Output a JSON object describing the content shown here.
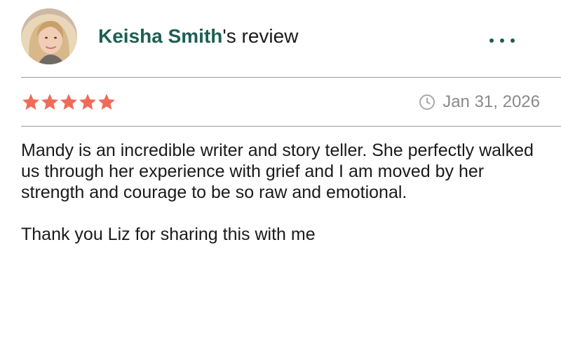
{
  "reviewer": {
    "name": "Keisha Smith",
    "suffix": "'s review"
  },
  "menu": {
    "icon": "more-horizontal-icon"
  },
  "rating": {
    "stars": 5,
    "max_stars": 5,
    "star_color": "#f06a5a"
  },
  "date": {
    "icon": "clock-icon",
    "text": "Jan 31, 2026"
  },
  "review": {
    "paragraph1": "Mandy is an incredible writer and story teller. She perfectly walked us through her experience with grief and I am moved by her strength and courage to be so raw and emotional.",
    "paragraph2": "Thank you Liz for sharing this with me"
  },
  "colors": {
    "accent": "#1d5e54",
    "divider": "#9a9a9a",
    "muted_text": "#8a8a8a"
  }
}
